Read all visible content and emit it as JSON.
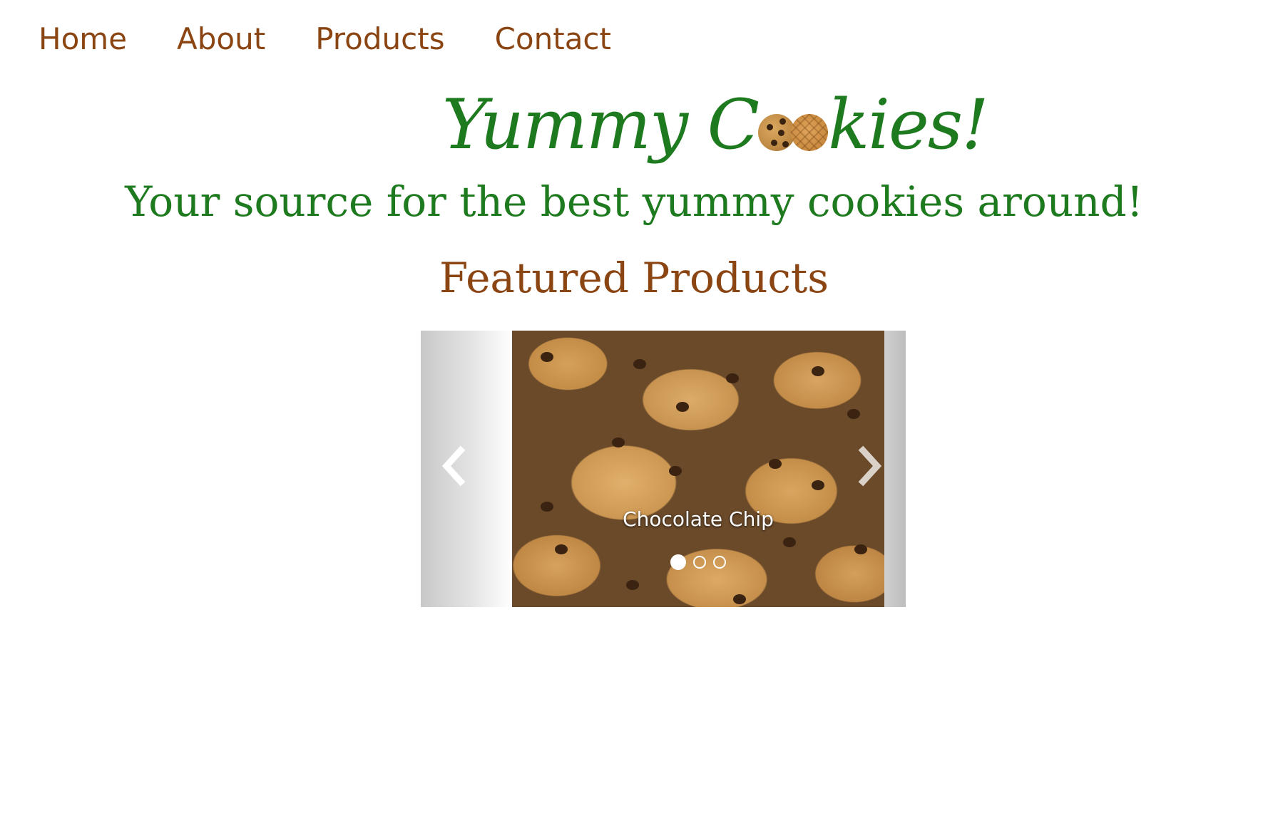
{
  "nav": {
    "items": [
      {
        "label": "Home"
      },
      {
        "label": "About"
      },
      {
        "label": "Products"
      },
      {
        "label": "Contact"
      }
    ]
  },
  "logo": {
    "text_before": "Yummy C",
    "text_after": "kies!"
  },
  "tagline": "Your source for the best yummy cookies around!",
  "featured_heading": "Featured Products",
  "carousel": {
    "current_caption": "Chocolate Chip",
    "slide_count": 3,
    "active_index": 0,
    "prev_icon": "chevron-left-icon",
    "next_icon": "chevron-right-icon"
  },
  "colors": {
    "nav_link": "#8b4513",
    "brand_green": "#1e7a1e",
    "heading_brown": "#8b4513"
  }
}
